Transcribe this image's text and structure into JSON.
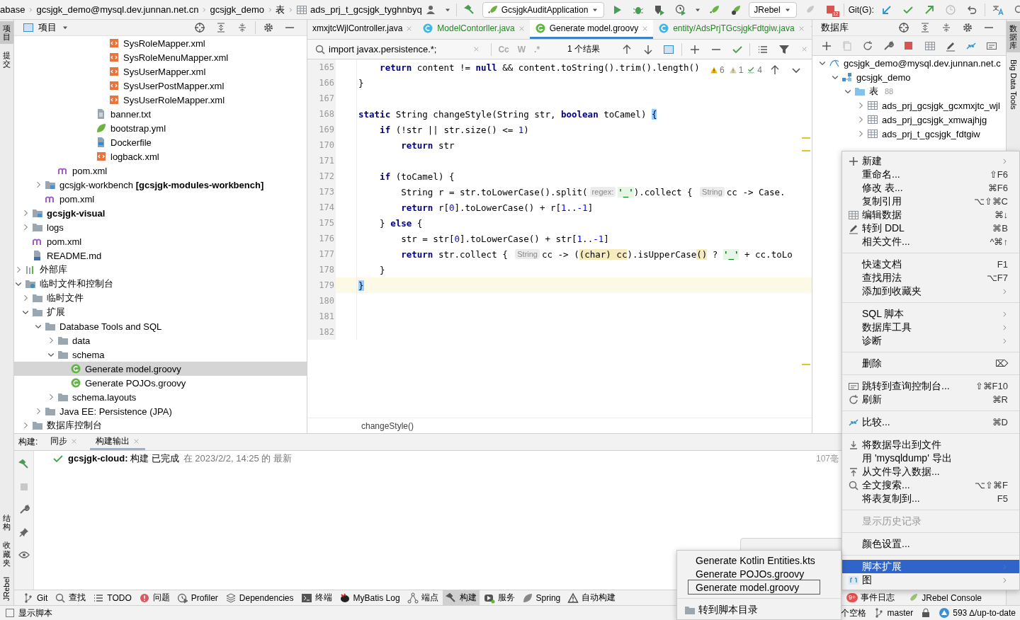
{
  "breadcrumbs": [
    {
      "label": "abase",
      "kind": "plain"
    },
    {
      "label": "gcsjgk_demo@mysql.dev.junnan.net.cn",
      "kind": "plain"
    },
    {
      "label": "gcsjgk_demo",
      "kind": "plain"
    },
    {
      "label": "表",
      "kind": "plain"
    },
    {
      "label": "ads_prj_t_gcsjgk_tyghnbyq",
      "kind": "table"
    }
  ],
  "toolbar": {
    "run_config": "GcsjgkAuditApplication",
    "jrebel_config": "JRebel",
    "stop_badge": "12",
    "git_label": "Git(G):"
  },
  "left_stripe": {
    "top": [
      {
        "label": "项目",
        "kind": "stacked",
        "selected": true
      },
      {
        "label": "提交",
        "kind": "stacked",
        "selected": false
      }
    ],
    "bottom": [
      {
        "label": "结构",
        "kind": "stacked",
        "selected": false
      },
      {
        "label": "收藏夹",
        "kind": "stacked",
        "selected": false
      },
      {
        "label": "JRebel",
        "kind": "rotated",
        "selected": false
      }
    ]
  },
  "right_stripe": [
    {
      "label": "数据库",
      "kind": "stacked",
      "selected": true
    },
    {
      "label": "Big Data Tools",
      "kind": "vertical",
      "selected": false
    }
  ],
  "project": {
    "title": "项目",
    "tree": [
      {
        "children": [
          {
            "children": [
              {
                "children": [
                  {
                    "children": [
                      {
                        "children": [
                          {
                            "children": [
                              {
                                "children": [
                                  {
                                    "label": "SysRoleMapper.xml",
                                    "kind": "xml",
                                    "selected": false
                                  },
                                  {
                                    "label": "SysRoleMenuMapper.xml",
                                    "kind": "xml",
                                    "selected": false
                                  },
                                  {
                                    "label": "SysUserMapper.xml",
                                    "kind": "xml",
                                    "selected": false
                                  },
                                  {
                                    "label": "SysUserPostMapper.xml",
                                    "kind": "xml",
                                    "selected": false
                                  },
                                  {
                                    "label": "SysUserRoleMapper.xml",
                                    "kind": "xml",
                                    "selected": false
                                  }
                                ]
                              },
                              {
                                "label": "banner.txt",
                                "kind": "text",
                                "selected": false
                              },
                              {
                                "label": "bootstrap.yml",
                                "kind": "yaml",
                                "selected": false
                              },
                              {
                                "label": "Dockerfile",
                                "kind": "docker",
                                "selected": false
                              },
                              {
                                "label": "logback.xml",
                                "kind": "xml",
                                "selected": false
                              }
                            ]
                          }
                        ]
                      }
                    ]
                  },
                  {
                    "label": "pom.xml",
                    "kind": "maven",
                    "selected": false
                  }
                ]
              },
              {
                "label": "gcsjgk-workbench **[gcsjgk-modules-workbench]**",
                "kind": "module",
                "expanded": false,
                "selected": false
              },
              {
                "label": "pom.xml",
                "kind": "maven",
                "selected": false
              }
            ]
          },
          {
            "label": "gcsjgk-visual",
            "kind": "module",
            "bold": true,
            "expanded": false,
            "selected": false
          },
          {
            "label": "logs",
            "kind": "folder",
            "expanded": false,
            "selected": false
          },
          {
            "label": "pom.xml",
            "kind": "maven",
            "selected": false
          },
          {
            "label": "README.md",
            "kind": "markdown",
            "selected": false
          }
        ]
      },
      {
        "label": "外部库",
        "kind": "libraries",
        "expanded": false,
        "selected": false
      },
      {
        "label": "临时文件和控制台",
        "kind": "scratch",
        "expanded": true,
        "selected": false,
        "children": [
          {
            "label": "临时文件",
            "kind": "folder",
            "expanded": false,
            "selected": false
          },
          {
            "label": "扩展",
            "kind": "folder",
            "expanded": true,
            "selected": false,
            "children": [
              {
                "label": "Database Tools and SQL",
                "kind": "folder",
                "expanded": true,
                "selected": false,
                "children": [
                  {
                    "label": "data",
                    "kind": "folder",
                    "expanded": false,
                    "selected": false
                  },
                  {
                    "label": "schema",
                    "kind": "folder",
                    "expanded": true,
                    "selected": false,
                    "children": [
                      {
                        "label": "Generate model.groovy",
                        "kind": "groovy",
                        "selected": true
                      },
                      {
                        "label": "Generate POJOs.groovy",
                        "kind": "groovy",
                        "selected": false
                      }
                    ]
                  },
                  {
                    "label": "schema.layouts",
                    "kind": "folder",
                    "expanded": false,
                    "selected": false
                  }
                ]
              },
              {
                "label": "Java EE: Persistence (JPA)",
                "kind": "folder",
                "expanded": false,
                "selected": false
              }
            ]
          },
          {
            "label": "数据库控制台",
            "kind": "folder",
            "expanded": false,
            "selected": false
          }
        ]
      }
    ]
  },
  "editor": {
    "tabs": [
      {
        "label": "xmxjtcWjlController.java",
        "kind": "cut",
        "selected": false
      },
      {
        "label": "ModelContorller.java",
        "kind": "class-added",
        "selected": false
      },
      {
        "label": "Generate model.groovy",
        "kind": "script",
        "selected": true
      },
      {
        "label": "entity/AdsPrjTGcsjgkFdtgiw.java",
        "kind": "class-added",
        "selected": false
      }
    ],
    "search": {
      "query": "import javax.persistence.*;",
      "options": [
        {
          "label": "Cc"
        },
        {
          "label": "W"
        },
        {
          "label": ".*"
        }
      ],
      "result": "1 个结果"
    },
    "inspections": [
      {
        "kind": "warning",
        "count": "6"
      },
      {
        "kind": "weak",
        "count": "1"
      },
      {
        "kind": "typo",
        "count": "4"
      }
    ],
    "lines": [
      {
        "number": "165",
        "current": false,
        "segments": [
          {
            "kind": "keyword",
            "text": "    return"
          },
          {
            "kind": "plain",
            "text": " content != "
          },
          {
            "kind": "keyword",
            "text": "null"
          },
          {
            "kind": "plain",
            "text": " && content.toString().trim().length()"
          }
        ]
      },
      {
        "number": "166",
        "current": false,
        "segments": [
          {
            "kind": "plain",
            "text": "}"
          }
        ]
      },
      {
        "number": "167",
        "current": false
      },
      {
        "number": "168",
        "current": false,
        "segments": [
          {
            "kind": "keyword",
            "text": "static"
          },
          {
            "kind": "plain",
            "text": " String changeStyle(String str, "
          },
          {
            "kind": "keyword",
            "text": "boolean"
          },
          {
            "kind": "plain",
            "text": " toCamel) "
          },
          {
            "kind": "brace",
            "text": "{"
          }
        ]
      },
      {
        "number": "169",
        "current": false,
        "segments": [
          {
            "kind": "keyword",
            "text": "    if"
          },
          {
            "kind": "plain",
            "text": " (!str || str.size() <= "
          },
          {
            "kind": "number",
            "text": "1"
          },
          {
            "kind": "plain",
            "text": ")"
          }
        ]
      },
      {
        "number": "170",
        "current": false,
        "segments": [
          {
            "kind": "keyword",
            "text": "        return"
          },
          {
            "kind": "plain",
            "text": " str"
          }
        ]
      },
      {
        "number": "171",
        "current": false
      },
      {
        "number": "172",
        "current": false,
        "segments": [
          {
            "kind": "keyword",
            "text": "    if"
          },
          {
            "kind": "plain",
            "text": " (toCamel) {"
          }
        ]
      },
      {
        "number": "173",
        "current": false,
        "segments": [
          {
            "kind": "plain",
            "text": "        String r = str.toLowerCase().split("
          },
          {
            "kind": "hint",
            "text": "regex:"
          },
          {
            "kind": "string",
            "text": "'_'"
          },
          {
            "kind": "plain",
            "text": ").collect { "
          },
          {
            "kind": "hint",
            "text": "String"
          },
          {
            "kind": "plain",
            "text": "cc -> Case."
          }
        ]
      },
      {
        "number": "174",
        "current": false,
        "segments": [
          {
            "kind": "keyword",
            "text": "        return"
          },
          {
            "kind": "plain",
            "text": " r["
          },
          {
            "kind": "number",
            "text": "0"
          },
          {
            "kind": "plain",
            "text": "].toLowerCase() + r["
          },
          {
            "kind": "number",
            "text": "1"
          },
          {
            "kind": "plain",
            "text": ".."
          },
          {
            "kind": "number",
            "text": "-1"
          },
          {
            "kind": "plain",
            "text": "]"
          }
        ]
      },
      {
        "number": "175",
        "current": false,
        "segments": [
          {
            "kind": "plain",
            "text": "    } "
          },
          {
            "kind": "keyword",
            "text": "else"
          },
          {
            "kind": "plain",
            "text": " {"
          }
        ]
      },
      {
        "number": "176",
        "current": false,
        "segments": [
          {
            "kind": "plain",
            "text": "        str = str["
          },
          {
            "kind": "number",
            "text": "0"
          },
          {
            "kind": "plain",
            "text": "].toLowerCase() + str["
          },
          {
            "kind": "number",
            "text": "1"
          },
          {
            "kind": "plain",
            "text": ".."
          },
          {
            "kind": "number",
            "text": "-1"
          },
          {
            "kind": "plain",
            "text": "]"
          }
        ]
      },
      {
        "number": "177",
        "current": false,
        "segments": [
          {
            "kind": "keyword",
            "text": "        return"
          },
          {
            "kind": "plain",
            "text": " str.collect { "
          },
          {
            "kind": "hint",
            "text": "String"
          },
          {
            "kind": "plain",
            "text": "cc -> ("
          },
          {
            "kind": "match",
            "text": "(char) cc"
          },
          {
            "kind": "plain",
            "text": ").isUpperCase"
          },
          {
            "kind": "match",
            "text": "()"
          },
          {
            "kind": "plain",
            "text": " ? "
          },
          {
            "kind": "string",
            "text": "'_'"
          },
          {
            "kind": "plain",
            "text": " + cc.toLo"
          }
        ]
      },
      {
        "number": "178",
        "current": false,
        "segments": [
          {
            "kind": "plain",
            "text": "    }"
          }
        ]
      },
      {
        "number": "179",
        "current": true,
        "segments": [
          {
            "kind": "brace",
            "text": "}"
          }
        ]
      },
      {
        "number": "180",
        "current": false
      },
      {
        "number": "181",
        "current": false
      },
      {
        "number": "182",
        "current": false
      }
    ],
    "breadcrumb": "changeStyle()"
  },
  "database": {
    "title": "数据库",
    "tree": [
      {
        "label": "gcsjgk_demo@mysql.dev.junnan.net.c",
        "kind": "datasource",
        "expanded": true,
        "selected": false,
        "children": [
          {
            "label": "gcsjgk_demo",
            "kind": "schema",
            "expanded": true,
            "selected": false,
            "children": [
              {
                "label": "表",
                "count": "88",
                "kind": "dbfolder",
                "expanded": true,
                "selected": false,
                "children": [
                  {
                    "label": "ads_prj_gcsjgk_gcxmxjtc_wjl",
                    "kind": "table",
                    "expanded": false,
                    "selected": false
                  },
                  {
                    "label": "ads_prj_gcsjgk_xmwajhjg",
                    "kind": "table",
                    "expanded": false,
                    "selected": false
                  },
                  {
                    "label": "ads_prj_t_gcsjgk_fdtgiw",
                    "kind": "table",
                    "expanded": false,
                    "selected": false
                  }
                ]
              }
            ]
          }
        ]
      }
    ]
  },
  "build": {
    "label": "构建:",
    "tabs": [
      {
        "label": "同步",
        "selected": false
      },
      {
        "label": "构建输出",
        "selected": true
      }
    ],
    "title": "**gcsjgk-cloud:** 构建 已完成",
    "detail": "在 2023/2/2, 14:25 的 最新",
    "duration": "107毫"
  },
  "tool_windows": [
    {
      "label": "Git",
      "kind": "git",
      "selected": false
    },
    {
      "label": "查找",
      "kind": "search",
      "selected": false
    },
    {
      "label": "TODO",
      "kind": "list",
      "selected": false
    },
    {
      "label": "问题",
      "kind": "error",
      "selected": false
    },
    {
      "label": "Profiler",
      "kind": "profiler",
      "selected": false
    },
    {
      "label": "Dependencies",
      "kind": "layers",
      "selected": false
    },
    {
      "label": "终端",
      "kind": "terminal",
      "selected": false
    },
    {
      "label": "MyBatis Log",
      "kind": "bird",
      "selected": false
    },
    {
      "label": "端点",
      "kind": "nodes",
      "selected": false
    },
    {
      "label": "构建",
      "kind": "hammer",
      "selected": true
    },
    {
      "label": "服务",
      "kind": "services",
      "selected": false
    },
    {
      "label": "Spring",
      "kind": "leaf",
      "selected": false
    },
    {
      "label": "自动构建",
      "kind": "triangle",
      "selected": false
    }
  ],
  "tool_windows_right": [
    {
      "label": "事件日志",
      "badge": "9+"
    },
    {
      "label": "JRebel Console"
    }
  ],
  "status": {
    "left": "显示脚本",
    "indent": "个空格",
    "branch": "master",
    "vcs": "593 ∆/up-to-date"
  },
  "context_menu": {
    "sections": [
      [
        {
          "label": "新建",
          "kind": "plus",
          "submenu": true,
          "disabled": false,
          "selected": false
        },
        {
          "label": "重命名...",
          "kind": "plain",
          "shortcut": "⇧F6",
          "submenu": false,
          "disabled": false,
          "selected": false
        },
        {
          "label": "修改 表...",
          "kind": "plain",
          "shortcut": "⌘F6",
          "submenu": false,
          "disabled": false,
          "selected": false
        },
        {
          "label": "复制引用",
          "kind": "plain",
          "shortcut": "⌥⇧⌘C",
          "submenu": false,
          "disabled": false,
          "selected": false
        },
        {
          "label": "编辑数据",
          "kind": "table",
          "shortcut": "⌘↓",
          "submenu": false,
          "disabled": false,
          "selected": false
        },
        {
          "label": "转到 DDL",
          "kind": "pencil",
          "shortcut": "⌘B",
          "submenu": false,
          "disabled": false,
          "selected": false
        },
        {
          "label": "相关文件...",
          "kind": "plain",
          "shortcut": "^⌘↑",
          "submenu": false,
          "disabled": false,
          "selected": false
        }
      ],
      [
        {
          "label": "快速文档",
          "kind": "plain",
          "shortcut": "F1",
          "submenu": false,
          "disabled": false,
          "selected": false
        },
        {
          "label": "查找用法",
          "kind": "plain",
          "shortcut": "⌥F7",
          "submenu": false,
          "disabled": false,
          "selected": false
        },
        {
          "label": "添加到收藏夹",
          "kind": "plain",
          "submenu": true,
          "disabled": false,
          "selected": false
        }
      ],
      [
        {
          "label": "SQL 脚本",
          "kind": "plain",
          "submenu": true,
          "disabled": false,
          "selected": false
        },
        {
          "label": "数据库工具",
          "kind": "plain",
          "submenu": true,
          "disabled": false,
          "selected": false
        },
        {
          "label": "诊断",
          "kind": "plain",
          "submenu": true,
          "disabled": false,
          "selected": false
        }
      ],
      [
        {
          "label": "删除",
          "kind": "plain",
          "shortcut": "⌦",
          "submenu": false,
          "disabled": false,
          "selected": false
        }
      ],
      [
        {
          "label": "跳转到查询控制台...",
          "kind": "console",
          "shortcut": "⇧⌘F10",
          "submenu": false,
          "disabled": false,
          "selected": false
        },
        {
          "label": "刷新",
          "kind": "refresh",
          "shortcut": "⌘R",
          "submenu": false,
          "disabled": false,
          "selected": false
        }
      ],
      [
        {
          "label": "比较...",
          "kind": "compare",
          "shortcut": "⌘D",
          "submenu": false,
          "disabled": false,
          "selected": false
        }
      ],
      [
        {
          "label": "将数据导出到文件",
          "kind": "download",
          "submenu": false,
          "disabled": false,
          "selected": false
        },
        {
          "label": "用 'mysqldump' 导出",
          "kind": "plain",
          "submenu": false,
          "disabled": false,
          "selected": false
        },
        {
          "label": "从文件导入数据...",
          "kind": "upload",
          "submenu": false,
          "disabled": false,
          "selected": false
        },
        {
          "label": "全文搜索...",
          "kind": "search",
          "shortcut": "⌥⇧⌘F",
          "submenu": false,
          "disabled": false,
          "selected": false
        },
        {
          "label": "将表复制到...",
          "kind": "plain",
          "shortcut": "F5",
          "submenu": false,
          "disabled": false,
          "selected": false
        }
      ],
      [
        {
          "label": "显示历史记录",
          "kind": "plain",
          "submenu": false,
          "disabled": true,
          "selected": false
        }
      ],
      [
        {
          "label": "颜色设置...",
          "kind": "plain",
          "submenu": false,
          "disabled": false,
          "selected": false
        }
      ],
      [
        {
          "label": "脚本扩展",
          "kind": "plain",
          "submenu": true,
          "disabled": false,
          "selected": true
        },
        {
          "label": "图",
          "kind": "diagram",
          "submenu": true,
          "disabled": false,
          "selected": false
        }
      ]
    ]
  },
  "submenu": {
    "sections": [
      [
        {
          "label": "Generate Kotlin Entities.kts",
          "kind": "plain",
          "outlined": false
        },
        {
          "label": "Generate POJOs.groovy",
          "kind": "plain",
          "outlined": false
        },
        {
          "label": "Generate model.groovy",
          "kind": "plain",
          "outlined": true
        }
      ],
      [
        {
          "label": "转到脚本目录",
          "kind": "folder",
          "outlined": false
        }
      ]
    ]
  }
}
